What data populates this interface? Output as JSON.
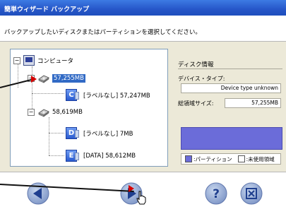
{
  "window": {
    "title": "簡単ウィザード バックアップ"
  },
  "instruction": "バックアップしたいディスクまたはパーティションを選択してください。",
  "tree": {
    "root": "コンピュータ",
    "disk1": "57,255MB",
    "part1": "[ラベルなし] 57,247MB",
    "part1_letter": "C",
    "disk2": "58,619MB",
    "part2": "[ラベルなし] 7MB",
    "part2_letter": "D",
    "part3": "[DATA] 58,612MB",
    "part3_letter": "E"
  },
  "disk_info": {
    "title": "ディスク情報",
    "device_type_label": "デバイス・タイプ:",
    "device_type_value": "Device type unknown",
    "total_size_label": "総領域サイズ:",
    "total_size_value": "57,255MB",
    "legend_partition": ":パーティション",
    "legend_unused": ":未使用領域"
  },
  "buttons": {
    "back": "戻る",
    "next": "次へ",
    "help": "ヘルプ",
    "close": "閉じる"
  },
  "colors": {
    "partition": "#6b6cd9",
    "selection": "#316ac5",
    "title_bar": "#2656c8"
  }
}
